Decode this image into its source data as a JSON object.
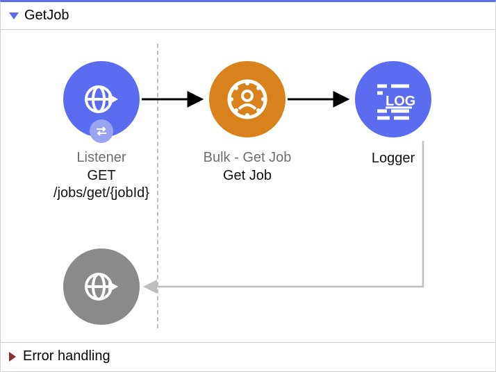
{
  "flow": {
    "title": "GetJob",
    "errorSection": "Error handling",
    "nodes": {
      "listener": {
        "type": "Listener",
        "label": "GET /jobs/get/{jobId}"
      },
      "getjob": {
        "type": "Bulk - Get Job",
        "label": "Get Job"
      },
      "logger": {
        "type": "",
        "label": "Logger"
      }
    }
  }
}
